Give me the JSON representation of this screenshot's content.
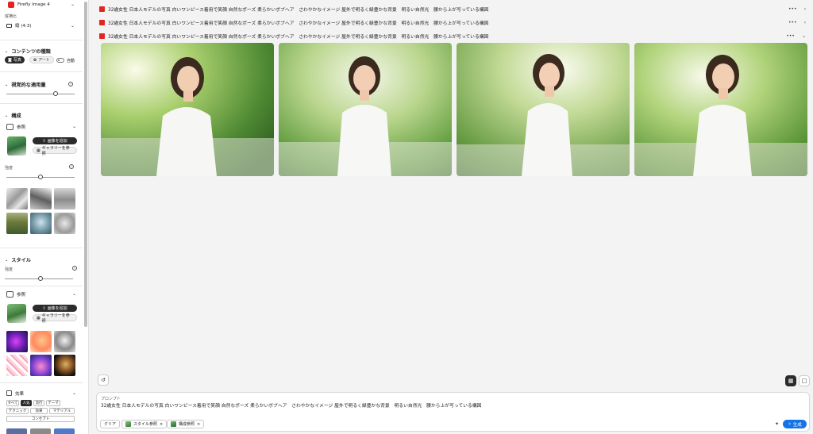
{
  "sidebar": {
    "model": {
      "label": "Firefly Image 4"
    },
    "aspect": {
      "label": "縦横比",
      "value": "縦 (4:3)"
    },
    "content_type": {
      "title": "コンテンツの種類",
      "photo": "写真",
      "art": "アート",
      "auto": "自動"
    },
    "visual_intensity": {
      "title": "視覚的な適用量",
      "value": 0.75
    },
    "composition": {
      "title": "構成",
      "reference": "参照",
      "add_image": "画像を追加",
      "browse_gallery": "ギャラリーを参照",
      "strength_label": "強度",
      "strength_value": 0.55
    },
    "style": {
      "title": "スタイル",
      "strength_label": "強度",
      "strength_value": 0.55,
      "reference": "参照",
      "add_image": "画像を追加",
      "browse_gallery": "ギャラリーを参照"
    },
    "effects": {
      "title": "効果",
      "tags": [
        "すべて",
        "人気",
        "流行",
        "テーマ",
        "テクニック",
        "効果",
        "マテリアル",
        "コンセプト"
      ]
    }
  },
  "main": {
    "history": [
      {
        "text": "32歳女性 日本人モデルの写真 白いワンピース着用で笑顔 自然なポーズ 柔らかいボブヘア　さわやかなイメージ 屋外で明るく緑豊かな背景　明るい自然光　腰から上が写っている構図"
      },
      {
        "text": "32歳女性 日本人モデルの写真 白いワンピース着用で笑顔 自然なポーズ 柔らかいボブヘア　さわやかなイメージ 屋外で明るく緑豊かな背景　明るい自然光　腰から上が写っている構図"
      },
      {
        "text": "32歳女性 日本人モデルの写真 白いワンピース着用で笑顔 自然なポーズ 柔らかいボブヘア　さわやかなイメージ 屋外で明るく緑豊かな背景　明るい自然光　腰から上が写っている構図"
      }
    ],
    "prompt": {
      "label": "プロンプト",
      "value": "32歳女性 日本人モデルの写真 白いワンピース着用で笑顔 自然なポーズ 柔らかいボブヘア　さわやかなイメージ 屋外で明るく緑豊かな背景　明るい自然光　腰から上が写っている構図",
      "clear": "クリア",
      "style_ref_chip": "スタイル参照",
      "comp_ref_chip": "構成参照",
      "generate": "生成"
    }
  },
  "colors": {
    "accent": "#1473e6",
    "brand": "#e4251f"
  }
}
